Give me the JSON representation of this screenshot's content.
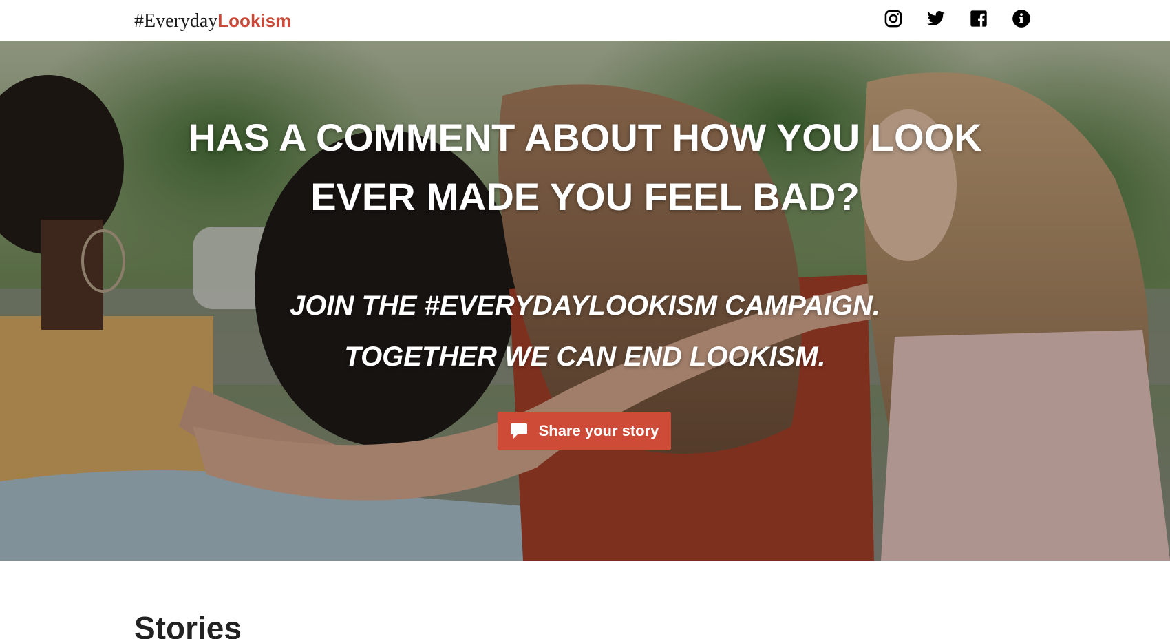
{
  "header": {
    "logo_part1": "#Everyday",
    "logo_part2": "Lookism",
    "social": [
      {
        "name": "instagram-icon"
      },
      {
        "name": "twitter-icon"
      },
      {
        "name": "facebook-icon"
      },
      {
        "name": "info-icon"
      }
    ]
  },
  "hero": {
    "headline_line1": "HAS A COMMENT ABOUT HOW YOU LOOK",
    "headline_line2": "EVER MADE YOU FEEL BAD?",
    "tagline_line1": "JOIN THE #EVERYDAYLOOKISM CAMPAIGN.",
    "tagline_line2": "TOGETHER WE CAN END LOOKISM.",
    "cta_label": "Share your story",
    "cta_icon": "speech-bubble-icon"
  },
  "stories": {
    "title": "Stories"
  },
  "colors": {
    "accent": "#cd4b37",
    "logo_accent": "#c94a38",
    "text_dark": "#111111"
  }
}
